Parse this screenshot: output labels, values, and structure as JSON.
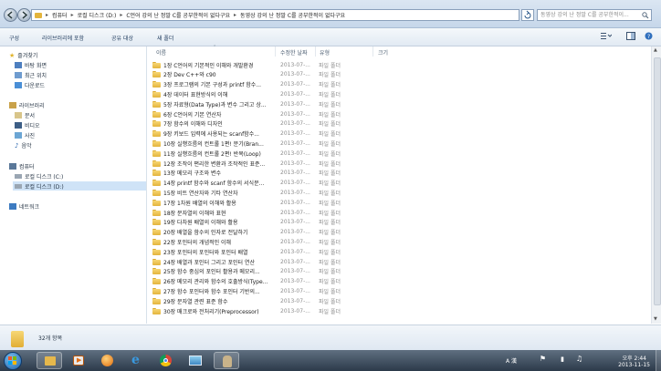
{
  "address": {
    "segments": [
      "컴퓨터",
      "로컬 디스크 (D:)",
      "C언어 강의 난 정말 C를 공부한적이 없다구요",
      "동영상 강의 난 정말 C를 공부한적이 없다구요"
    ],
    "search_placeholder": "동영상 강의 난 정말 C를 공부한적이..."
  },
  "toolbar": {
    "organize": "구성",
    "include_library": "라이브러리에 포함",
    "share_with": "공유 대상",
    "new_folder": "새 폴더"
  },
  "sidebar": {
    "favorites_title": "즐겨찾기",
    "favorites": [
      "바탕 화면",
      "최근 위치",
      "다운로드"
    ],
    "libraries_title": "라이브러리",
    "libraries": [
      "문서",
      "비디오",
      "사진",
      "음악"
    ],
    "computer_title": "컴퓨터",
    "drives": [
      "로컬 디스크 (C:)",
      "로컬 디스크 (D:)"
    ],
    "network": "네트워크"
  },
  "columns": {
    "name": "이름",
    "date": "수정한 날짜",
    "type": "유형",
    "size": "크기"
  },
  "files": [
    {
      "name": "1장 C언어의 기본적인 이해와 개발환경",
      "date": "2013-07-...",
      "type": "파일 폴더"
    },
    {
      "name": "2장 Dev C++와 c90",
      "date": "2013-07-...",
      "type": "파일 폴더"
    },
    {
      "name": "3장 프로그램의 기본 구성과 printf 함수...",
      "date": "2013-07-...",
      "type": "파일 폴더"
    },
    {
      "name": "4장 데이터 표현방식의 이해",
      "date": "2013-07-...",
      "type": "파일 폴더"
    },
    {
      "name": "5장 자료형(Data Type)과 변수 그리고 상...",
      "date": "2013-07-...",
      "type": "파일 폴더"
    },
    {
      "name": "6장 C언어의 기본 연산자",
      "date": "2013-07-...",
      "type": "파일 폴더"
    },
    {
      "name": "7장 함수의 이해와 디자인",
      "date": "2013-07-...",
      "type": "파일 폴더"
    },
    {
      "name": "9장 키보드 입력에 사용되는 scanf함수...",
      "date": "2013-07-...",
      "type": "파일 폴더"
    },
    {
      "name": "10장 실행흐름의 컨트롤 1편! 분기(Bran...",
      "date": "2013-07-...",
      "type": "파일 폴더"
    },
    {
      "name": "11장 실행흐름의 컨트롤 2편! 반복(Loop)",
      "date": "2013-07-...",
      "type": "파일 폴더"
    },
    {
      "name": "12장 조작이 편리한 변환과 조작적인 표준...",
      "date": "2013-07-...",
      "type": "파일 폴더"
    },
    {
      "name": "13장 메모리 구조와 변수",
      "date": "2013-07-...",
      "type": "파일 폴더"
    },
    {
      "name": "14장 printf 함수와 scanf 함수의 서식문...",
      "date": "2013-07-...",
      "type": "파일 폴더"
    },
    {
      "name": "15장 비트 연산자와 기타 연산자",
      "date": "2013-07-...",
      "type": "파일 폴더"
    },
    {
      "name": "17장 1차원 배열의 이해와 활용",
      "date": "2013-07-...",
      "type": "파일 폴더"
    },
    {
      "name": "18장 문자열의 이해와 표현",
      "date": "2013-07-...",
      "type": "파일 폴더"
    },
    {
      "name": "19장 다차원 배열의 이해와 활용",
      "date": "2013-07-...",
      "type": "파일 폴더"
    },
    {
      "name": "20장 배열을 함수의 인자로 전달하기",
      "date": "2013-07-...",
      "type": "파일 폴더"
    },
    {
      "name": "22장 포인터의 개념적인 이해",
      "date": "2013-07-...",
      "type": "파일 폴더"
    },
    {
      "name": "23장 포인터의 포인터와 포인터 배열",
      "date": "2013-07-...",
      "type": "파일 폴더"
    },
    {
      "name": "24장 배열과 포인터 그리고 포인터 연산",
      "date": "2013-07-...",
      "type": "파일 폴더"
    },
    {
      "name": "25장 함수 중심의 포인터 활용과 메모리...",
      "date": "2013-07-...",
      "type": "파일 폴더"
    },
    {
      "name": "26장 메모리 관리와 함수의 호출방식(Type...",
      "date": "2013-07-...",
      "type": "파일 폴더"
    },
    {
      "name": "27장 함수 포인터와 함수 포인터 기반의...",
      "date": "2013-07-...",
      "type": "파일 폴더"
    },
    {
      "name": "29장 문자열 관련 표준 함수",
      "date": "2013-07-...",
      "type": "파일 폴더"
    },
    {
      "name": "30장 매크로와 전처리기(Preprocessor)",
      "date": "2013-07-...",
      "type": "파일 폴더"
    }
  ],
  "status": {
    "item_count": "32개 항목"
  },
  "taskbar": {
    "ime": "A 漢",
    "time": "오후 2:44",
    "date": "2013-11-15"
  }
}
